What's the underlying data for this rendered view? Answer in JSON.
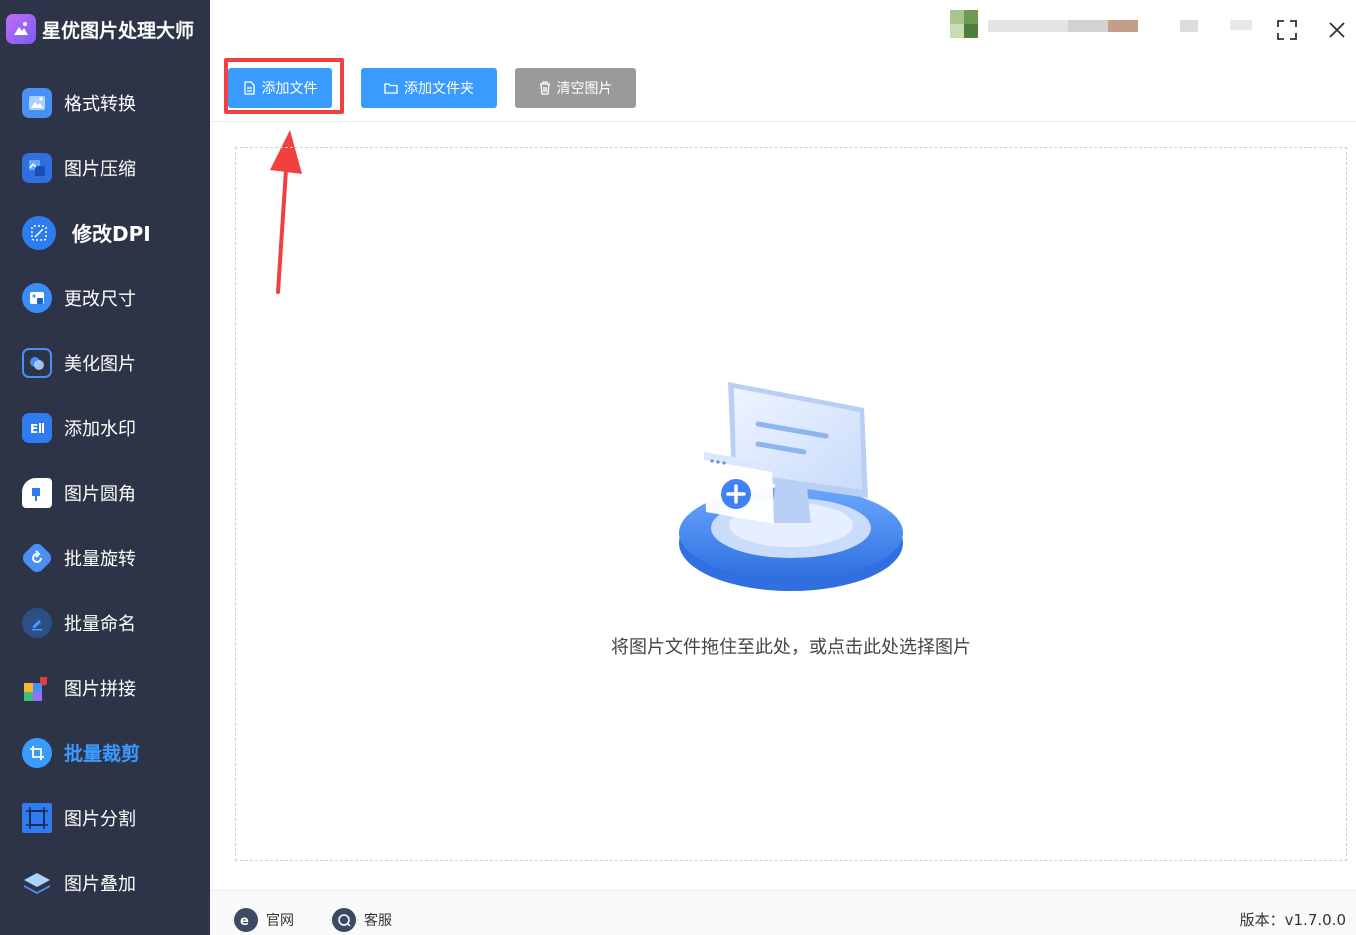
{
  "app": {
    "title": "星优图片处理大师"
  },
  "sidebar": {
    "items": [
      {
        "label": "格式转换",
        "icon": "image-convert-icon"
      },
      {
        "label": "图片压缩",
        "icon": "image-compress-icon"
      },
      {
        "label": "修改DPI",
        "icon": "dpi-icon"
      },
      {
        "label": "更改尺寸",
        "icon": "resize-icon"
      },
      {
        "label": "美化图片",
        "icon": "beautify-icon"
      },
      {
        "label": "添加水印",
        "icon": "watermark-icon"
      },
      {
        "label": "图片圆角",
        "icon": "round-corner-icon"
      },
      {
        "label": "批量旋转",
        "icon": "rotate-icon"
      },
      {
        "label": "批量命名",
        "icon": "rename-icon"
      },
      {
        "label": "图片拼接",
        "icon": "puzzle-icon"
      },
      {
        "label": "批量裁剪",
        "icon": "crop-icon"
      },
      {
        "label": "图片分割",
        "icon": "split-icon"
      },
      {
        "label": "图片叠加",
        "icon": "layers-icon"
      }
    ]
  },
  "toolbar": {
    "add_file": "添加文件",
    "add_folder": "添加文件夹",
    "clear_images": "清空图片"
  },
  "dropzone": {
    "hint": "将图片文件拖住至此处，或点击此处选择图片"
  },
  "footer": {
    "website": "官网",
    "support": "客服",
    "version": "版本：v1.7.0.0"
  },
  "colors": {
    "sidebar_bg": "#2e3447",
    "accent": "#3a9bff",
    "highlight": "#f04040",
    "gray_button": "#9a9a9a"
  }
}
